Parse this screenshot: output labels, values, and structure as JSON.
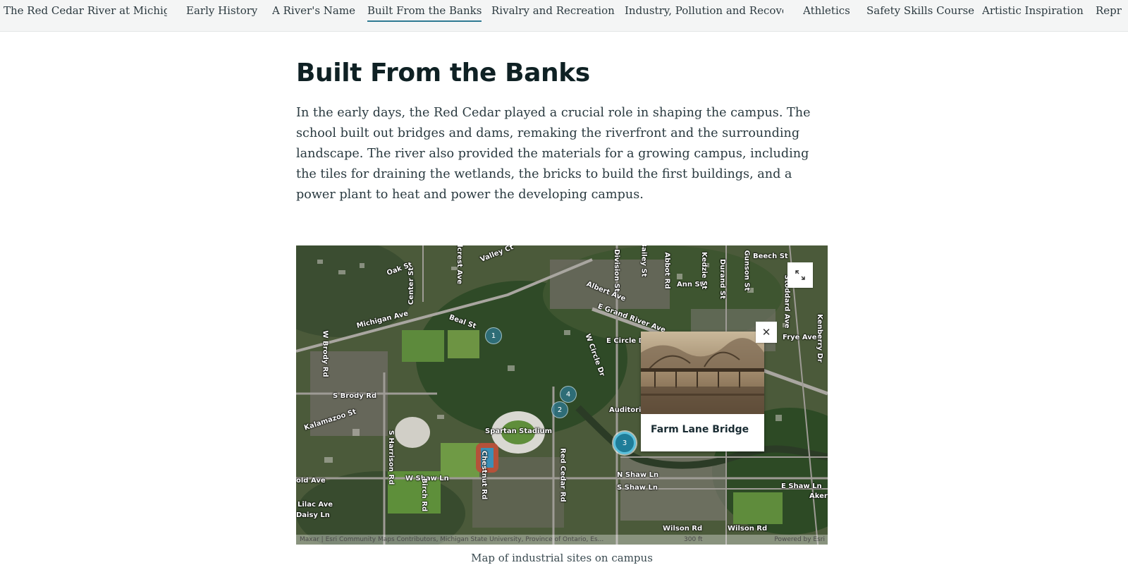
{
  "nav": {
    "items": [
      {
        "label": "The Red Cedar River at Michiga...",
        "active": false
      },
      {
        "label": "Early History",
        "active": false
      },
      {
        "label": "A River's Name",
        "active": false
      },
      {
        "label": "Built From the Banks",
        "active": true
      },
      {
        "label": "Rivalry and Recreation",
        "active": false
      },
      {
        "label": "Industry, Pollution and Recove...",
        "active": false
      },
      {
        "label": "Athletics",
        "active": false
      },
      {
        "label": "Safety Skills Course",
        "active": false
      },
      {
        "label": "Artistic Inspiration",
        "active": false
      },
      {
        "label": "Repr",
        "active": false
      }
    ]
  },
  "article": {
    "title": "Built From the Banks",
    "intro": "In the early days, the Red Cedar played a crucial role in shaping the campus. The school built out bridges and dams, remaking the riverfront and the surrounding landscape. The river also provided the materials for a growing campus, including the tiles for draining the wetlands, the bricks to build the first buildings, and a power plant to heat and power the developing campus."
  },
  "map": {
    "streets": [
      "Valley Ct",
      "Oak St",
      "Center St",
      "Beal St",
      "Michigan Ave",
      "W Brody Rd",
      "S Brody Rd",
      "Kalamazoo St",
      "S Harrison Rd",
      "Spartan Stadium",
      "Chestnut Rd",
      "W Shaw Ln",
      "Birch Rd",
      "Red Cedar Rd",
      "Albert Ave",
      "E Grand River Ave",
      "E Circle Dr",
      "W Circle Dr",
      "Auditorium",
      "N Shaw Ln",
      "S Shaw Ln",
      "Wilson Rd",
      "Ann St",
      "Beech St",
      "Frye Ave",
      "E Shaw Ln",
      "Lilac Ave",
      "Daisy Ln",
      "old Ave",
      "Durand St",
      "Gunson St",
      "Kedzie St",
      "Bailey St",
      "Division St",
      "Stoddard Ave",
      "Kenberry Dr",
      "Abbot Rd",
      "Hillcrest Ave",
      "Wilson Rd",
      "Akers Rd"
    ],
    "markers": [
      {
        "label": "1",
        "active": false
      },
      {
        "label": "4",
        "active": false
      },
      {
        "label": "2",
        "active": false
      },
      {
        "label": "3",
        "active": true
      }
    ],
    "popup": {
      "title": "Farm Lane Bridge",
      "close_symbol": "✕"
    },
    "expand_icon": "expand-icon",
    "attribution": "Maxar | Esri Community Maps Contributors, Michigan State University, Province of Ontario, Es...",
    "scale_text": "300 ft",
    "powered_by": "Powered by Esri",
    "caption": "Map of industrial sites on campus"
  },
  "colors": {
    "accent": "#2f7a93",
    "marker": "#1f7d99"
  }
}
